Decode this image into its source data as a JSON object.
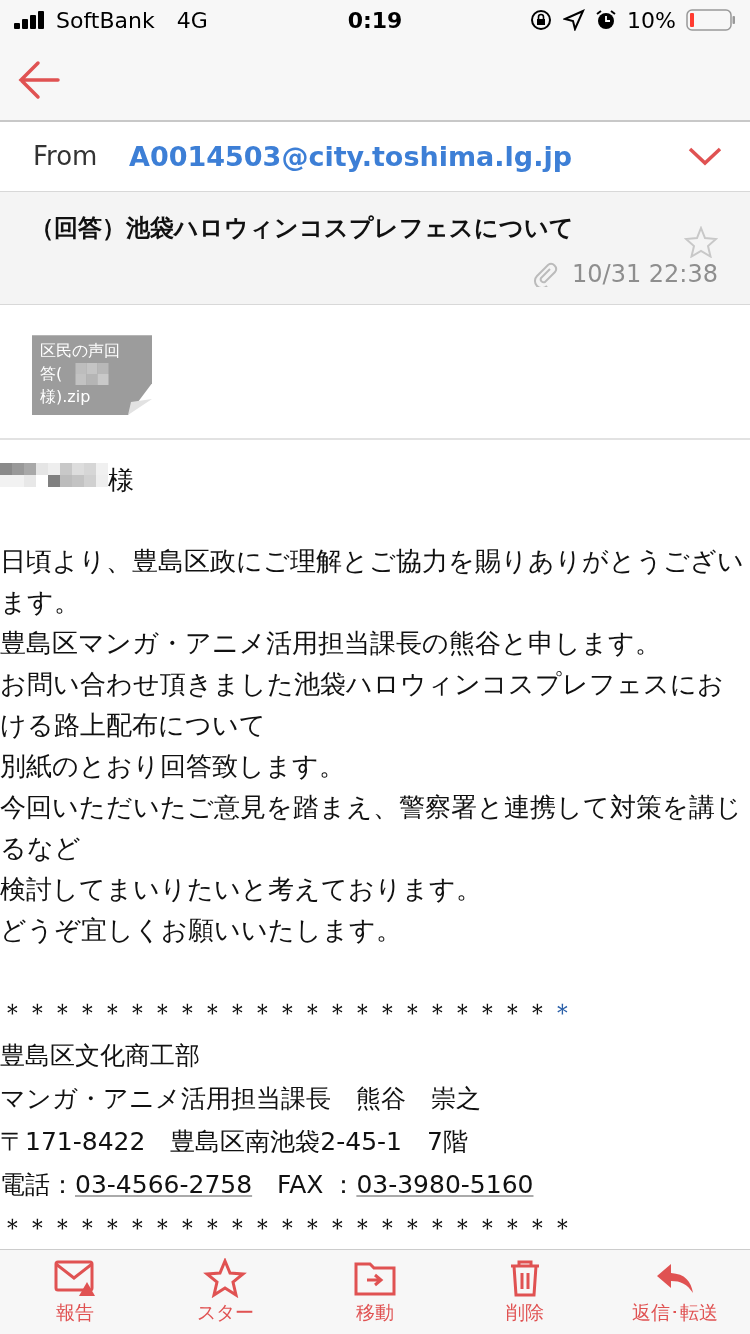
{
  "status_bar": {
    "carrier": "SoftBank",
    "network": "4G",
    "time": "0:19",
    "battery": "10%"
  },
  "from": {
    "label": "From",
    "address": "A0014503@city.toshima.lg.jp"
  },
  "subject": {
    "title": "（回答）池袋ハロウィンコスプレフェスについて",
    "starred": false,
    "date": "10/31 22:38"
  },
  "attachment": {
    "name_lines": [
      "区民の声回",
      "答(",
      "様).zip"
    ]
  },
  "salutation": {
    "suffix": "様"
  },
  "body": [
    "日頃より、豊島区政にご理解とご協力を賜りありがとうございます。",
    "豊島区マンガ・アニメ活用担当課長の熊谷と申します。",
    "お問い合わせ頂きました池袋ハロウィンコスプレフェスにおける路上配布について",
    "別紙のとおり回答致します。",
    "今回いただいたご意見を踏まえ、警察署と連携して対策を講じるなど",
    "検討してまいりたいと考えております。",
    "どうぞ宜しくお願いいたします。"
  ],
  "signature": {
    "rule_top": "＊＊＊＊＊＊＊＊＊＊＊＊＊＊＊＊＊＊＊＊＊＊",
    "rule_top_link": "＊",
    "lines": [
      "豊島区文化商工部",
      "マンガ・アニメ活用担当課長　熊谷　崇之",
      "〒171-8422　豊島区南池袋2-45-1　7階"
    ],
    "phone_label": "電話：",
    "phone": "03-4566-2758",
    "fax_label": "　FAX ：",
    "fax": "03-3980-5160",
    "rule_bottom": "＊＊＊＊＊＊＊＊＊＊＊＊＊＊＊＊＊＊＊＊＊＊＊"
  },
  "toolbar": [
    {
      "kind": "report",
      "label": "報告"
    },
    {
      "kind": "star",
      "label": "スター"
    },
    {
      "kind": "move",
      "label": "移動"
    },
    {
      "kind": "delete",
      "label": "削除"
    },
    {
      "kind": "reply",
      "label": "返信･転送"
    }
  ]
}
